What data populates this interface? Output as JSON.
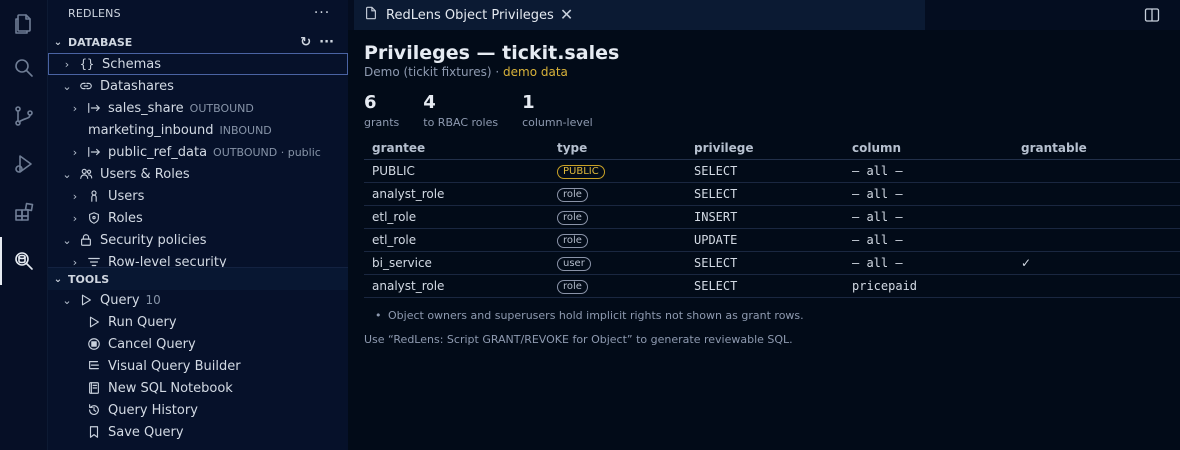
{
  "sidebar": {
    "title": "REDLENS",
    "database_section": "DATABASE",
    "tools_section": "TOOLS",
    "tree": {
      "schemas": "Schemas",
      "datashares": "Datashares",
      "sales_share": "sales_share",
      "sales_share_desc": "OUTBOUND",
      "marketing_inbound": "marketing_inbound",
      "marketing_inbound_desc": "INBOUND",
      "public_ref_data": "public_ref_data",
      "public_ref_data_desc": "OUTBOUND · public",
      "users_roles": "Users & Roles",
      "users": "Users",
      "roles": "Roles",
      "security_policies": "Security policies",
      "row_level_security": "Row-level security"
    },
    "tools": {
      "query": "Query",
      "query_count": "10",
      "run_query": "Run Query",
      "cancel_query": "Cancel Query",
      "visual_query_builder": "Visual Query Builder",
      "new_sql_notebook": "New SQL Notebook",
      "query_history": "Query History",
      "save_query": "Save Query"
    }
  },
  "tab": {
    "label": "RedLens Object Privileges"
  },
  "page": {
    "title": "Privileges — tickit.sales",
    "subtitle_prefix": "Demo (tickit fixtures) · ",
    "subtitle_demo": "demo data",
    "stats": [
      {
        "num": "6",
        "label": "grants"
      },
      {
        "num": "4",
        "label": "to RBAC roles"
      },
      {
        "num": "1",
        "label": "column-level"
      }
    ],
    "columns": [
      "grantee",
      "type",
      "privilege",
      "column",
      "grantable"
    ],
    "rows": [
      {
        "grantee": "PUBLIC",
        "type": "PUBLIC",
        "privilege": "SELECT",
        "column": "– all –",
        "grantable": ""
      },
      {
        "grantee": "analyst_role",
        "type": "role",
        "privilege": "SELECT",
        "column": "– all –",
        "grantable": ""
      },
      {
        "grantee": "etl_role",
        "type": "role",
        "privilege": "INSERT",
        "column": "– all –",
        "grantable": ""
      },
      {
        "grantee": "etl_role",
        "type": "role",
        "privilege": "UPDATE",
        "column": "– all –",
        "grantable": ""
      },
      {
        "grantee": "bi_service",
        "type": "user",
        "privilege": "SELECT",
        "column": "– all –",
        "grantable": "✓"
      },
      {
        "grantee": "analyst_role",
        "type": "role",
        "privilege": "SELECT",
        "column": "pricepaid",
        "grantable": ""
      }
    ],
    "note": "Object owners and superusers hold implicit rights not shown as grant rows.",
    "hint": "Use “RedLens: Script GRANT/REVOKE for Object” to generate reviewable SQL."
  },
  "icons": {
    "activity": [
      "files-icon",
      "search-icon",
      "source-control-icon",
      "run-debug-icon",
      "extensions-icon",
      "redlens-icon"
    ]
  }
}
